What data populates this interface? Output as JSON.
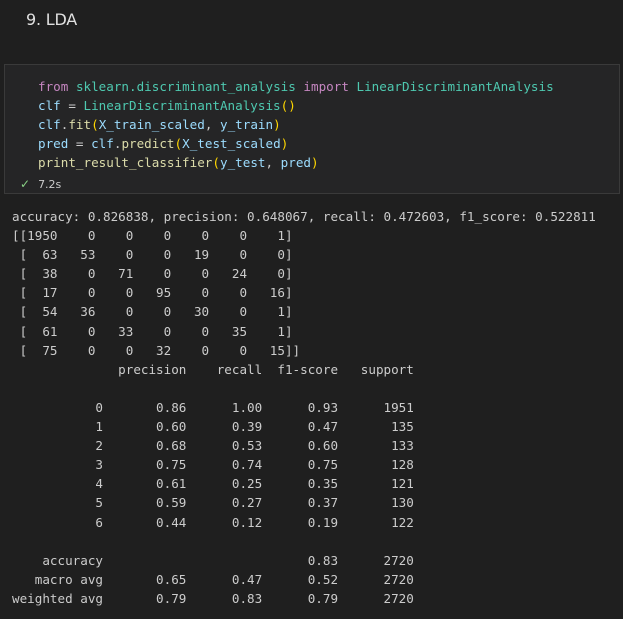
{
  "heading": "9. LDA",
  "code": {
    "line1": {
      "kw_from": "from",
      "module": "sklearn.discriminant_analysis",
      "kw_import": "import",
      "cls": "LinearDiscriminantAnalysis"
    },
    "line2": {
      "var": "clf",
      "op": " = ",
      "cls": "LinearDiscriminantAnalysis",
      "paren": "()"
    },
    "line3": {
      "obj": "clf",
      "dot": ".",
      "fn": "fit",
      "p_open": "(",
      "arg1": "X_train_scaled",
      "sep": ", ",
      "arg2": "y_train",
      "p_close": ")"
    },
    "line4": {
      "var": "pred",
      "op": " = ",
      "obj": "clf",
      "dot": ".",
      "fn": "predict",
      "p_open": "(",
      "arg1": "X_test_scaled",
      "p_close": ")"
    },
    "line5": {
      "fn": "print_result_classifier",
      "p_open": "(",
      "arg1": "y_test",
      "sep": ", ",
      "arg2": "pred",
      "p_close": ")"
    }
  },
  "status": {
    "icon": "check-icon",
    "time": "7.2s"
  },
  "output": {
    "lines": [
      "accuracy: 0.826838, precision: 0.648067, recall: 0.472603, f1_score: 0.522811",
      "[[1950    0    0    0    0    0    1]",
      " [  63   53    0    0   19    0    0]",
      " [  38    0   71    0    0   24    0]",
      " [  17    0    0   95    0    0   16]",
      " [  54   36    0    0   30    0    1]",
      " [  61    0   33    0    0   35    1]",
      " [  75    0    0   32    0    0   15]]",
      "              precision    recall  f1-score   support",
      "",
      "           0       0.86      1.00      0.93      1951",
      "           1       0.60      0.39      0.47       135",
      "           2       0.68      0.53      0.60       133",
      "           3       0.75      0.74      0.75       128",
      "           4       0.61      0.25      0.35       121",
      "           5       0.59      0.27      0.37       130",
      "           6       0.44      0.12      0.19       122",
      "",
      "    accuracy                           0.83      2720",
      "   macro avg       0.65      0.47      0.52      2720",
      "weighted avg       0.79      0.83      0.79      2720"
    ]
  }
}
